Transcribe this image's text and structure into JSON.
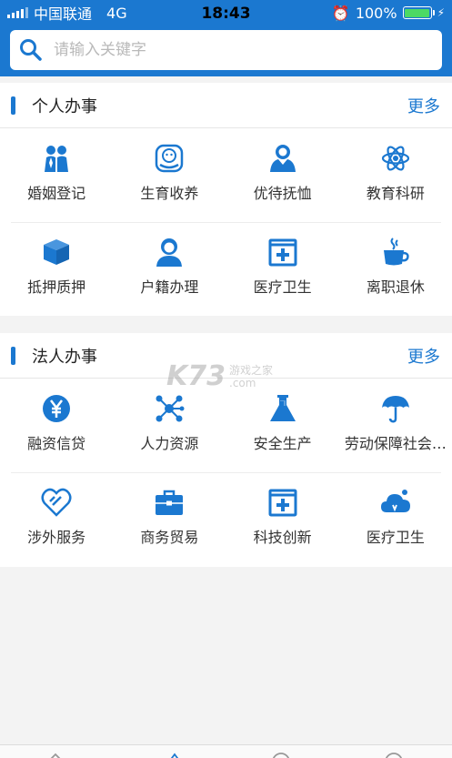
{
  "status_bar": {
    "carrier": "中国联通",
    "network": "4G",
    "time": "18:43",
    "battery": "100%"
  },
  "search": {
    "placeholder": "请输入关键字"
  },
  "personal": {
    "title": "个人办事",
    "more": "更多",
    "items": [
      {
        "label": "婚姻登记",
        "icon": "couple-icon"
      },
      {
        "label": "生育收养",
        "icon": "baby-icon"
      },
      {
        "label": "优待抚恤",
        "icon": "people-icon"
      },
      {
        "label": "教育科研",
        "icon": "atom-icon"
      },
      {
        "label": "抵押质押",
        "icon": "box-icon"
      },
      {
        "label": "户籍办理",
        "icon": "person-icon"
      },
      {
        "label": "医疗卫生",
        "icon": "medical-cross-icon"
      },
      {
        "label": "离职退休",
        "icon": "coffee-cup-icon"
      }
    ]
  },
  "legal": {
    "title": "法人办事",
    "more": "更多",
    "items": [
      {
        "label": "融资信贷",
        "icon": "yen-coin-icon"
      },
      {
        "label": "人力资源",
        "icon": "network-icon"
      },
      {
        "label": "安全生产",
        "icon": "flask-icon"
      },
      {
        "label": "劳动保障社会…",
        "icon": "umbrella-icon"
      },
      {
        "label": "涉外服务",
        "icon": "heart-icon"
      },
      {
        "label": "商务贸易",
        "icon": "briefcase-icon"
      },
      {
        "label": "科技创新",
        "icon": "plus-box-icon"
      },
      {
        "label": "医疗卫生",
        "icon": "cloud-icon"
      }
    ]
  },
  "watermark": {
    "brand": "K73",
    "line1": "游戏之家",
    "line2": ".com"
  },
  "colors": {
    "primary": "#1b78d0",
    "background": "#f3f3f3"
  }
}
